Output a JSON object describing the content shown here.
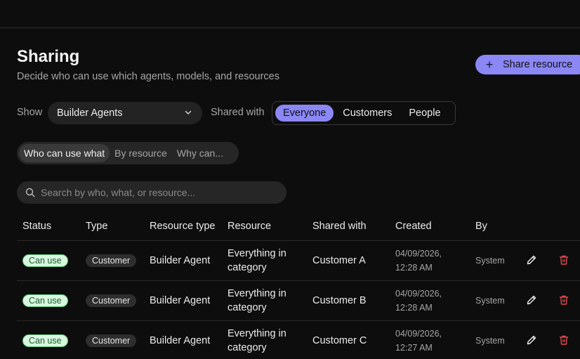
{
  "header": {
    "title": "Sharing",
    "subtitle": "Decide who can use which agents, models, and resources",
    "share_button": "Share resource"
  },
  "filters": {
    "show_label": "Show",
    "show_value": "Builder Agents",
    "shared_with_label": "Shared with",
    "shared_with_options": [
      "Everyone",
      "Customers",
      "People"
    ],
    "shared_with_selected": "Everyone"
  },
  "tabs": {
    "items": [
      "Who can use what",
      "By resource",
      "Why can..."
    ],
    "active": "Who can use what"
  },
  "search": {
    "placeholder": "Search by who, what, or resource..."
  },
  "table": {
    "columns": [
      "Status",
      "Type",
      "Resource type",
      "Resource",
      "Shared with",
      "Created",
      "By"
    ],
    "rows": [
      {
        "status": "Can use",
        "type": "Customer",
        "resource_type": "Builder Agent",
        "resource_line1": "Everything in",
        "resource_line2": "category",
        "shared_with": "Customer A",
        "created_line1": "04/09/2026,",
        "created_line2": "12:28 AM",
        "by": "System"
      },
      {
        "status": "Can use",
        "type": "Customer",
        "resource_type": "Builder Agent",
        "resource_line1": "Everything in",
        "resource_line2": "category",
        "shared_with": "Customer B",
        "created_line1": "04/09/2026,",
        "created_line2": "12:28 AM",
        "by": "System"
      },
      {
        "status": "Can use",
        "type": "Customer",
        "resource_type": "Builder Agent",
        "resource_line1": "Everything in",
        "resource_line2": "category",
        "shared_with": "Customer C",
        "created_line1": "04/09/2026,",
        "created_line2": "12:27 AM",
        "by": "System"
      }
    ]
  },
  "colors": {
    "accent": "#8b87f5",
    "status_green_bg": "#d8f7df",
    "delete_red": "#e5484d"
  },
  "icons": [
    "plus-icon",
    "chevron-down-icon",
    "search-icon",
    "pencil-icon",
    "trash-icon"
  ]
}
